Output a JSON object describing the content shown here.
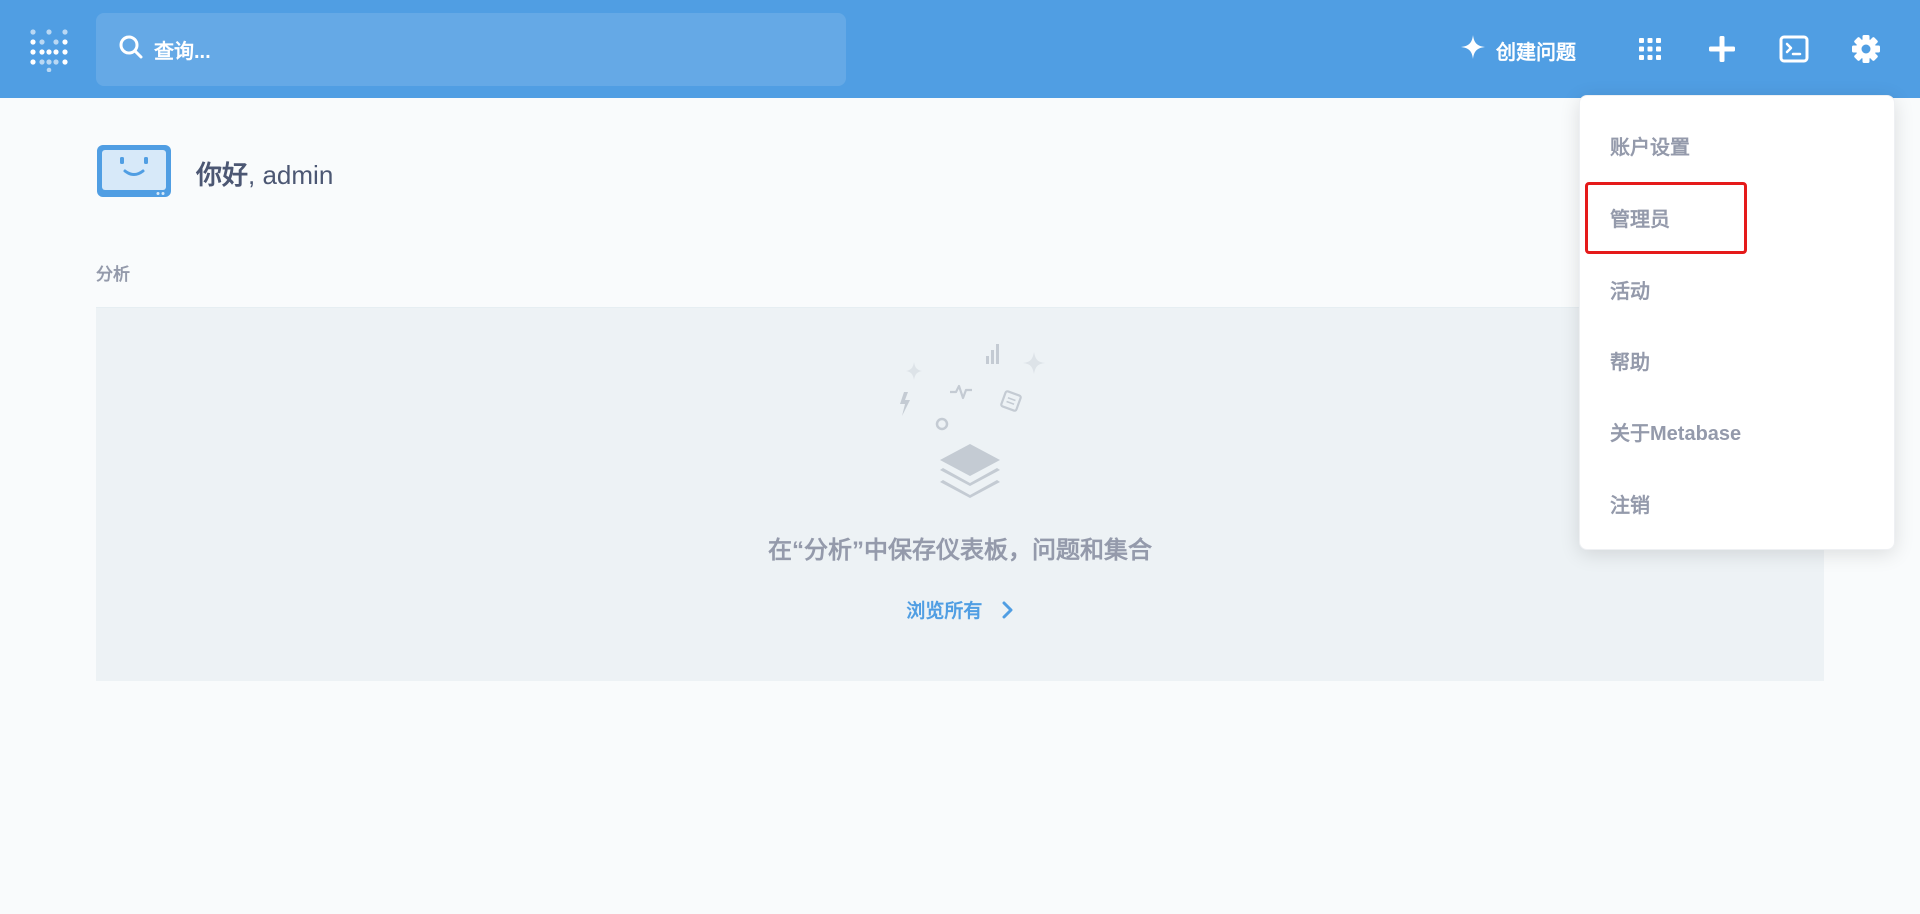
{
  "nav": {
    "search_placeholder": "查询...",
    "new_question_label": "创建问题",
    "icons": [
      "grid-icon",
      "plus-icon",
      "sql-editor-icon",
      "gear-icon"
    ]
  },
  "greeting": {
    "hello": "你好",
    "username": ", admin"
  },
  "section": {
    "title": "分析",
    "empty_message": "在“分析”中保存仪表板，问题和集合",
    "browse_all": "浏览所有"
  },
  "menu": {
    "items": [
      {
        "label": "账户设置"
      },
      {
        "label": "管理员"
      },
      {
        "label": "活动"
      },
      {
        "label": "帮助"
      },
      {
        "label": "关于Metabase"
      },
      {
        "label": "注销"
      }
    ]
  },
  "colors": {
    "brand": "#509EE3",
    "highlight": "#E51A1A"
  }
}
